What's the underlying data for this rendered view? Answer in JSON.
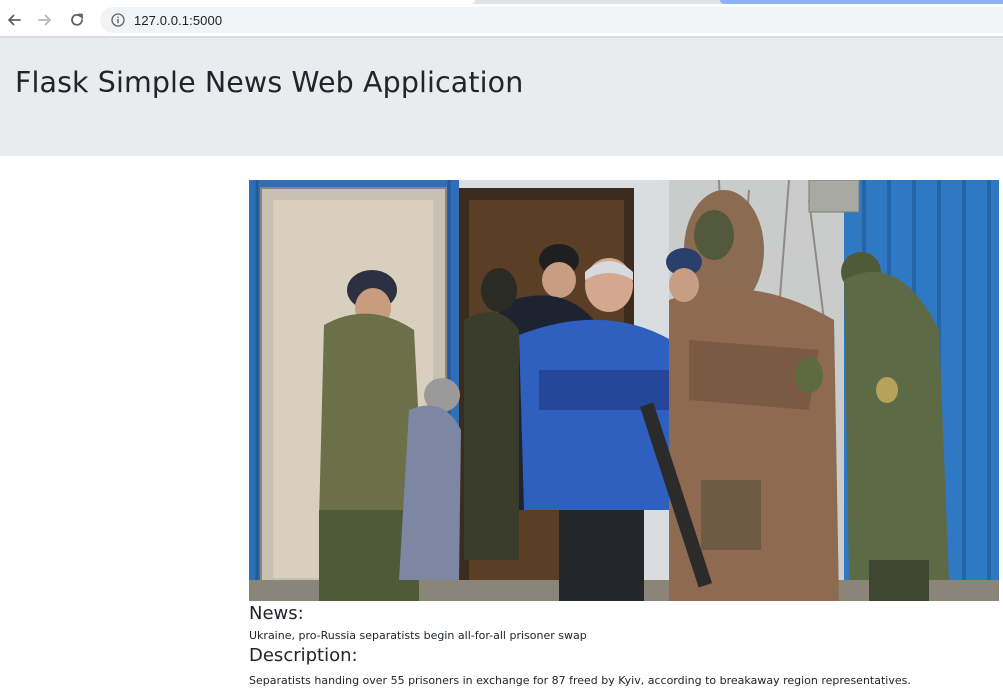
{
  "browser": {
    "url": "127.0.0.1:5000"
  },
  "header": {
    "title": "Flask Simple News Web Application"
  },
  "article": {
    "news_heading": "News:",
    "news_title": "Ukraine, pro-Russia separatists begin all-for-all prisoner swap",
    "description_heading": "Description:",
    "description_text": "Separatists handing over 55 prisoners in exchange for 87 freed by Kyiv, according to breakaway region representatives."
  },
  "colors": {
    "header_bg": "#e9ecef",
    "container_blue": "#2f6fb8",
    "jacket_blue": "#2f5fbf"
  }
}
